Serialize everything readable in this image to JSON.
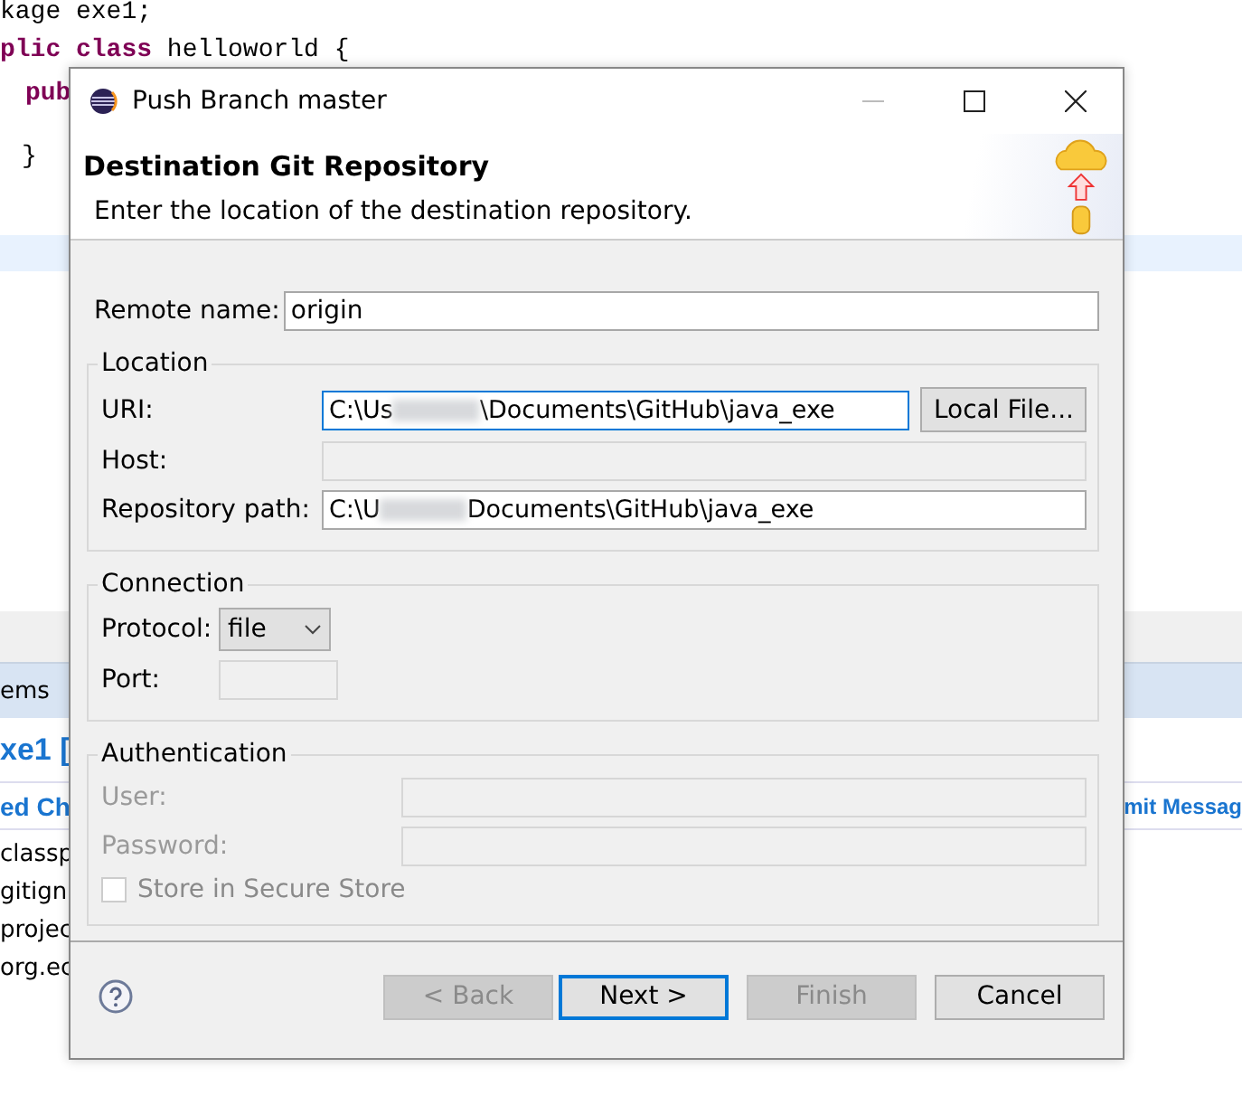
{
  "editor": {
    "code_lines": [
      {
        "text": "kage exe1;"
      },
      {
        "keyword": "plic class",
        "text": " helloworld {"
      },
      {
        "keyword": "pub"
      },
      {
        "text": "}"
      }
    ],
    "view_tab": "ems",
    "project_title": "xe1 [",
    "column_left": "ed Ch",
    "column_right": "mit Messag",
    "files": [
      "classp",
      "gitign",
      "projec",
      "org.ec"
    ]
  },
  "window": {
    "title": "Push Branch master"
  },
  "header": {
    "title": "Destination Git Repository",
    "description": "Enter the location of the destination repository."
  },
  "remote_name": {
    "label": "Remote name:",
    "value": "origin"
  },
  "location": {
    "legend": "Location",
    "uri": {
      "label": "URI:",
      "value_start": "C:\\Us",
      "value_end": "\\Documents\\GitHub\\java_exe",
      "button": "Local File..."
    },
    "host": {
      "label": "Host:"
    },
    "repository_path": {
      "label": "Repository path:",
      "value_start": "C:\\U",
      "value_end": "Documents\\GitHub\\java_exe"
    }
  },
  "connection": {
    "legend": "Connection",
    "protocol": {
      "label": "Protocol:",
      "value": "file"
    },
    "port": {
      "label": "Port:"
    }
  },
  "authentication": {
    "legend": "Authentication",
    "disabled": true,
    "user": {
      "label": "User:"
    },
    "password": {
      "label": "Password:"
    },
    "store": {
      "label": "Store in Secure Store",
      "checked": false
    }
  },
  "buttons": [
    {
      "label": "< Back",
      "disabled": true,
      "default": false
    },
    {
      "label": "Next >",
      "disabled": false,
      "default": true
    },
    {
      "label": "Finish",
      "disabled": true,
      "default": false
    },
    {
      "label": "Cancel",
      "disabled": false,
      "default": false
    }
  ]
}
